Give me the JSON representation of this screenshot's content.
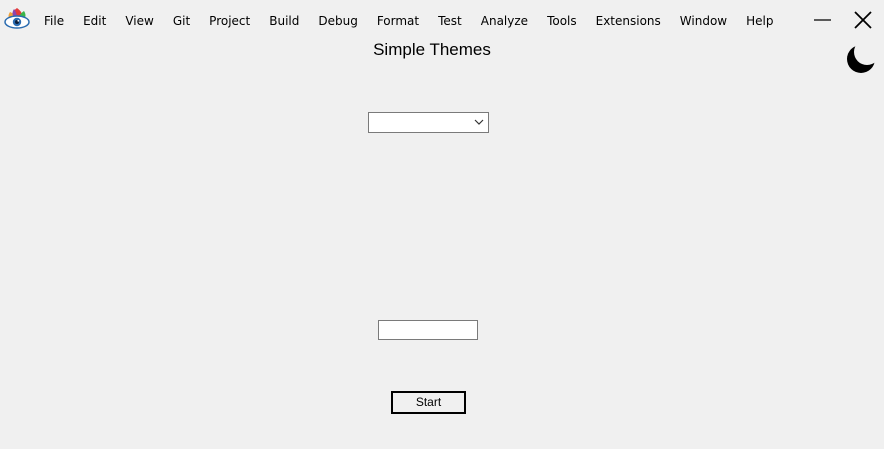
{
  "app": {
    "icon": "eye-logo-icon"
  },
  "menu": {
    "items": [
      {
        "label": "File"
      },
      {
        "label": "Edit"
      },
      {
        "label": "View"
      },
      {
        "label": "Git"
      },
      {
        "label": "Project"
      },
      {
        "label": "Build"
      },
      {
        "label": "Debug"
      },
      {
        "label": "Format"
      },
      {
        "label": "Test"
      },
      {
        "label": "Analyze"
      },
      {
        "label": "Tools"
      },
      {
        "label": "Extensions"
      },
      {
        "label": "Window"
      },
      {
        "label": "Help"
      }
    ]
  },
  "window_controls": {
    "minimize_icon": "minimize-icon",
    "close_icon": "close-icon"
  },
  "theme_toggle": {
    "icon": "moon-icon"
  },
  "page": {
    "title": "Simple Themes"
  },
  "theme_select": {
    "value": "",
    "icon": "chevron-down-icon"
  },
  "text_input": {
    "value": "",
    "placeholder": ""
  },
  "start_button": {
    "label": "Start"
  },
  "colors": {
    "background": "#f0f0f0",
    "field_background": "#ffffff",
    "field_border": "#7a7a7a",
    "text": "#000000"
  }
}
